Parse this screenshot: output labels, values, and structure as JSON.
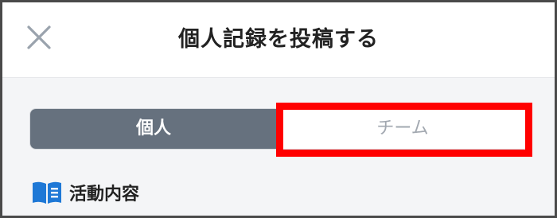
{
  "header": {
    "title": "個人記録を投稿する",
    "close_icon": "close-icon"
  },
  "segmented_control": {
    "options": [
      {
        "label": "個人",
        "selected": true
      },
      {
        "label": "チーム",
        "selected": false
      }
    ]
  },
  "section": {
    "icon": "book-icon",
    "label": "活動内容"
  },
  "colors": {
    "selected_segment": "#66717e",
    "highlight": "#ff0000",
    "book_icon": "#1e78d6"
  }
}
